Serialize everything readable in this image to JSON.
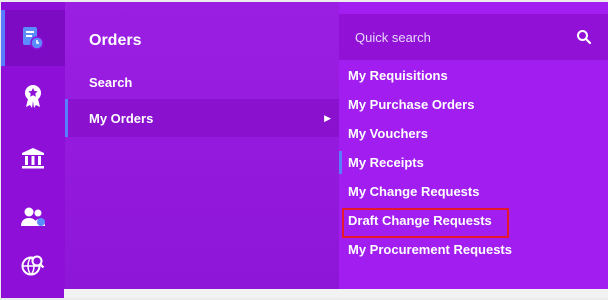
{
  "rail": {
    "icons": [
      "reports-icon",
      "award-ribbon-icon",
      "bank-icon",
      "users-icon",
      "globe-search-icon"
    ]
  },
  "orders_panel": {
    "title": "Orders",
    "items": [
      {
        "label": "Search"
      },
      {
        "label": "My Orders",
        "arrow": "▶"
      }
    ]
  },
  "submenu": {
    "search_placeholder": "Quick search",
    "items": [
      {
        "label": "My Requisitions"
      },
      {
        "label": "My Purchase Orders"
      },
      {
        "label": "My Vouchers"
      },
      {
        "label": "My Receipts"
      },
      {
        "label": "My Change Requests"
      },
      {
        "label": "Draft Change Requests"
      },
      {
        "label": "My Procurement Requests"
      }
    ]
  },
  "colors": {
    "background": "#9a16de",
    "accent": "#5a7dff",
    "highlight": "#e5192c"
  }
}
